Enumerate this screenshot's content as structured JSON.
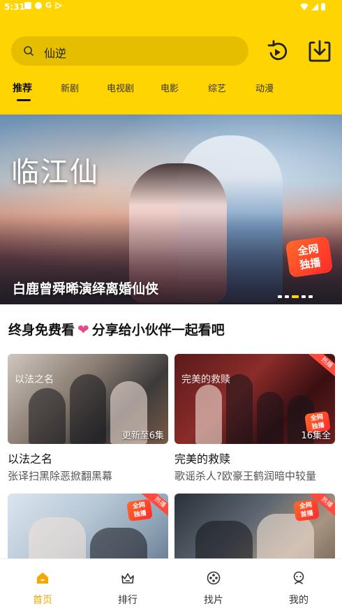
{
  "status_bar": {
    "time": "5:31",
    "google_g": "G"
  },
  "search": {
    "query": "仙逆"
  },
  "tabs": [
    "推荐",
    "新剧",
    "电视剧",
    "电影",
    "综艺",
    "动漫"
  ],
  "banner": {
    "logo_text": "临江仙",
    "badge_line1": "全网",
    "badge_line2": "独播",
    "title": "白鹿曾舜晞演绎离婚仙侠",
    "dots": 5,
    "active_dot": 2
  },
  "section": {
    "title_part1": "终身免费看",
    "title_part2": "分享给小伙伴一起看吧"
  },
  "cards": [
    {
      "title": "以法之名",
      "subtitle": "张译扫黑除恶掀翻黑幕",
      "episodes": "更新至6集",
      "thumb_text": "以法之名"
    },
    {
      "title": "完美的救赎",
      "subtitle": "歌谣杀人?欧豪王鹤润暗中较量",
      "episodes": "16集全",
      "thumb_text": "完美的救赎",
      "hot": "热播",
      "badge_line1": "全网",
      "badge_line2": "独播"
    },
    {
      "hot": "热播",
      "badge_line1": "全网",
      "badge_line2": "独播"
    },
    {
      "hot": "热播",
      "badge_line1": "全网",
      "badge_line2": "首播"
    }
  ],
  "bottom_nav": [
    {
      "label": "首页",
      "icon": "home-icon",
      "active": true
    },
    {
      "label": "排行",
      "icon": "ranking-icon",
      "active": false
    },
    {
      "label": "找片",
      "icon": "film-reel-icon",
      "active": false
    },
    {
      "label": "我的",
      "icon": "profile-icon",
      "active": false
    }
  ],
  "colors": {
    "accent": "#FFD400",
    "nav_active": "#F5A800",
    "heart": "#e24a8a"
  }
}
